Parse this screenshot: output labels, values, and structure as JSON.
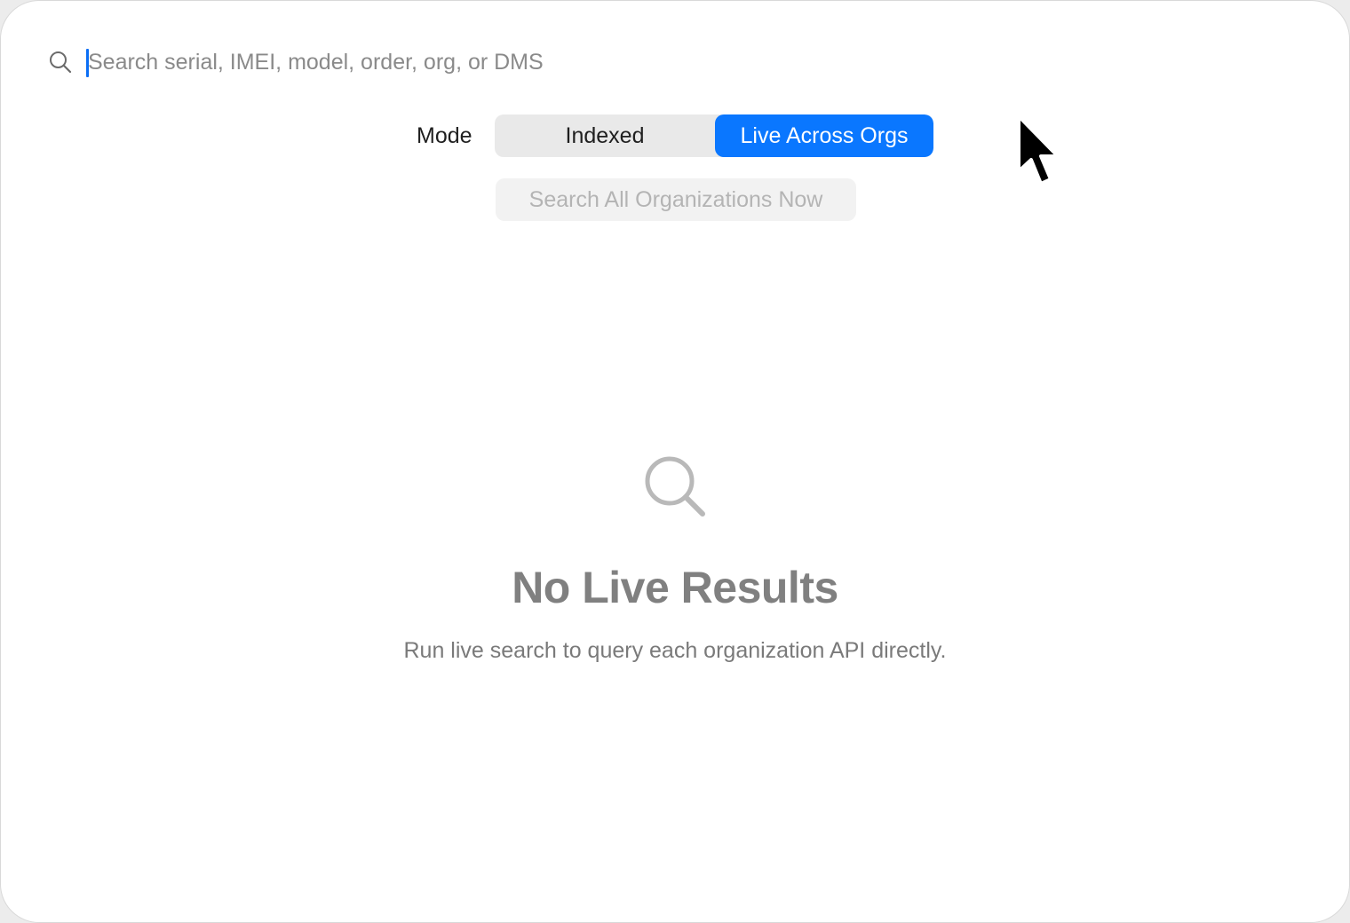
{
  "search": {
    "placeholder": "Search serial, IMEI, model, order, org, or DMS",
    "value": ""
  },
  "mode": {
    "label": "Mode",
    "options": [
      "Indexed",
      "Live Across Orgs"
    ],
    "selected": "Live Across Orgs"
  },
  "actions": {
    "search_all_label": "Search All Organizations Now"
  },
  "empty_state": {
    "icon": "magnifying-glass-icon",
    "title": "No Live Results",
    "subtitle": "Run live search to query each organization API directly."
  },
  "colors": {
    "accent": "#0a77ff",
    "empty_title": "#808080",
    "disabled_text": "#b4b4b4"
  }
}
